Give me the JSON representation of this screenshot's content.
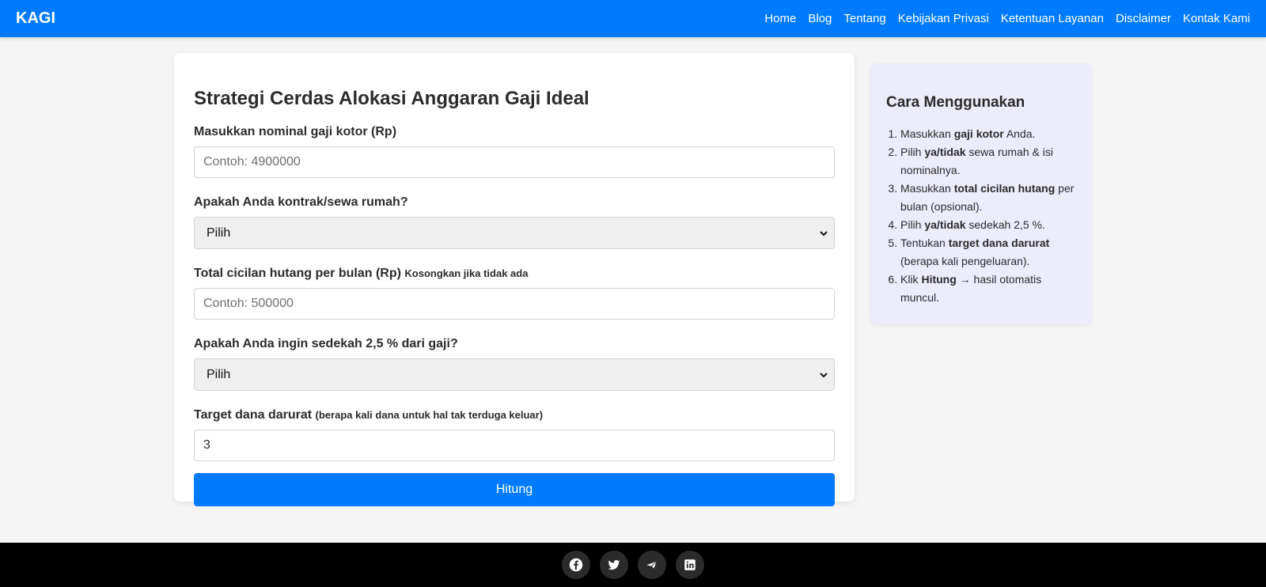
{
  "navbar": {
    "brand": "KAGI",
    "links": [
      "Home",
      "Blog",
      "Tentang",
      "Kebijakan Privasi",
      "Ketentuan Layanan",
      "Disclaimer",
      "Kontak Kami"
    ]
  },
  "form": {
    "title": "Strategi Cerdas Alokasi Anggaran Gaji Ideal",
    "salary": {
      "label": "Masukkan nominal gaji kotor (Rp)",
      "placeholder": "Contoh: 4900000"
    },
    "rent": {
      "label": "Apakah Anda kontrak/sewa rumah?",
      "selected": "Pilih"
    },
    "debt": {
      "label": "Total cicilan hutang per bulan (Rp)",
      "hint": "Kosongkan jika tidak ada",
      "placeholder": "Contoh: 500000"
    },
    "charity": {
      "label": "Apakah Anda ingin sedekah 2,5 % dari gaji?",
      "selected": "Pilih"
    },
    "emergency": {
      "label": "Target dana darurat",
      "hint": "(berapa kali dana untuk hal tak terduga keluar)",
      "value": "3"
    },
    "submit_label": "Hitung"
  },
  "guide": {
    "title": "Cara Menggunakan",
    "steps": [
      {
        "pre": "Masukkan ",
        "bold": "gaji kotor",
        "post": " Anda."
      },
      {
        "pre": "Pilih ",
        "bold": "ya/tidak",
        "post": " sewa rumah & isi nominalnya."
      },
      {
        "pre": "Masukkan ",
        "bold": "total cicilan hutang",
        "post": " per bulan (opsional)."
      },
      {
        "pre": "Pilih ",
        "bold": "ya/tidak",
        "post": " sedekah 2,5 %."
      },
      {
        "pre": "Tentukan ",
        "bold": "target dana darurat",
        "post": " (berapa kali pengeluaran)."
      },
      {
        "pre": "Klik ",
        "bold": "Hitung",
        "post": " → hasil otomatis muncul."
      }
    ]
  },
  "footer": {
    "icons": [
      "facebook-icon",
      "twitter-icon",
      "telegram-icon",
      "linkedin-icon"
    ]
  },
  "colors": {
    "primary": "#007bff",
    "guide_bg": "#ececfd",
    "footer_bg": "#000000"
  }
}
